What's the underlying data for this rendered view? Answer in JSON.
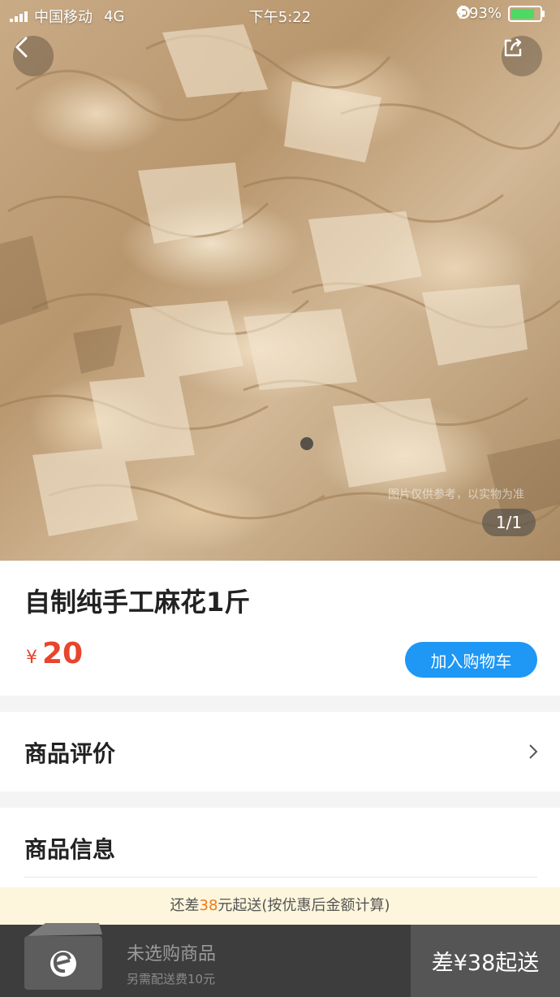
{
  "status_bar": {
    "carrier": "中国移动",
    "network": "4G",
    "time": "下午5:22",
    "battery_percent": "93%",
    "battery_level": 0.93,
    "battery_color": "#4cd964"
  },
  "gallery": {
    "counter": "1/1",
    "watermark": "图片仅供参考，以实物为准"
  },
  "product": {
    "title": "自制纯手工麻花1斤",
    "currency": "¥",
    "price": "20",
    "add_to_cart_label": "加入购物车",
    "price_color": "#e8452c",
    "accent_color": "#1e97f5"
  },
  "sections": {
    "reviews_title": "商品评价",
    "info_title": "商品信息"
  },
  "notice": {
    "prefix": "还差",
    "amount": "38",
    "suffix": "元起送(按优惠后金额计算)"
  },
  "bottom_bar": {
    "cart_empty_label": "未选购商品",
    "delivery_fee_label": "另需配送费10元",
    "checkout_label": "差¥38起送"
  },
  "icons": {
    "back": "back-arrow-icon",
    "share": "share-icon",
    "chevron": "chevron-right-icon",
    "cart": "cart-box-icon",
    "alarm": "alarm-icon",
    "lock": "orientation-lock-icon",
    "charging": "charging-bolt-icon"
  }
}
